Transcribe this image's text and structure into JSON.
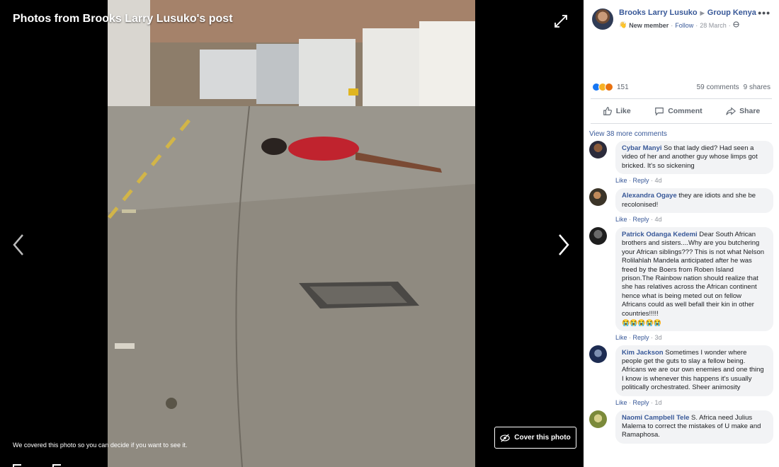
{
  "viewer": {
    "title": "Photos from Brooks Larry Lusuko's post",
    "cover_note": "We covered this photo so you can decide if you want to see it.",
    "cover_button_label": "Cover this photo"
  },
  "post": {
    "author": "Brooks Larry Lusuko",
    "group": "Group Kenya",
    "badge": "New member",
    "follow": "Follow",
    "date": "28 March",
    "reaction_count": "151",
    "comments_count": "59 comments",
    "shares_count": "9 shares"
  },
  "actions": {
    "like": "Like",
    "comment": "Comment",
    "share": "Share"
  },
  "view_more": "View 38 more comments",
  "comments": [
    {
      "author": "Cybar Manyi",
      "text": "So that lady died? Had seen a video of her and another guy whose limps got bricked. It's so sickening",
      "like": "Like",
      "reply": "Reply",
      "time": "4d"
    },
    {
      "author": "Alexandra Ogaye",
      "text": "they are idiots and she be recolonised!",
      "like": "Like",
      "reply": "Reply",
      "time": "4d"
    },
    {
      "author": "Patrick Odanga Kedemi",
      "text": "Dear South African brothers and sisters....Why are you butchering your African siblings??? This is not what Nelson Rolilahlah Mandela anticipated after he was freed by the Boers from Roben Island prison.The Rainbow nation should realize that she has relatives across the African continent hence what is being meted out on fellow Africans could as well befall their kin in other countries!!!!!",
      "emojis": "😭😭😭😭😭",
      "like": "Like",
      "reply": "Reply",
      "time": "3d"
    },
    {
      "author": "Kim Jackson",
      "text": "Sometimes I wonder where people get the guts to slay a fellow being. Africans we are our own enemies and one thing I know is whenever this happens it's usually politically orchestrated. Sheer animosity",
      "like": "Like",
      "reply": "Reply",
      "time": "1d"
    },
    {
      "author": "Naomi Campbell Tele",
      "text": "S. Africa need Julius Malema to correct the mistakes of U make and Ramaphosa.",
      "like": "Like",
      "reply": "Reply",
      "time": ""
    }
  ],
  "colors": {
    "link": "#385898",
    "bubble": "#f2f3f5",
    "muted": "#90949c"
  }
}
